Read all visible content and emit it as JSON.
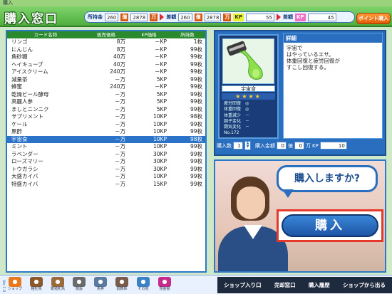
{
  "window": {
    "title": "購入"
  },
  "header": {
    "title": "購入窓口"
  },
  "money": {
    "funds_label": "所持金",
    "funds_oku": "260",
    "funds_man": "2878",
    "oku_unit": "億",
    "man_unit": "万",
    "diff_label": "差額",
    "diff_oku": "260",
    "diff_man": "2878",
    "kp_label": "KP",
    "kp_value": "55",
    "kp_diff_label": "差額",
    "kp_diff_value": "45",
    "point_button": "ポイント購入"
  },
  "table": {
    "headers": [
      "カード名称",
      "販売価格",
      "KP価格",
      "所持数"
    ],
    "rows": [
      [
        "リンゴ",
        "8万",
        "－KP",
        "1枚"
      ],
      [
        "にんじん",
        "8万",
        "－KP",
        "99枚"
      ],
      [
        "角砂糖",
        "40万",
        "－KP",
        "99枚"
      ],
      [
        "ヘイキューブ",
        "40万",
        "－KP",
        "99枚"
      ],
      [
        "アイスクリーム",
        "240万",
        "－KP",
        "99枚"
      ],
      [
        "減量茶",
        "－万",
        "5KP",
        "99枚"
      ],
      [
        "蜂蜜",
        "240万",
        "－KP",
        "99枚"
      ],
      [
        "乾燥ビール酵母",
        "－万",
        "5KP",
        "99枚"
      ],
      [
        "高麗人参",
        "－万",
        "5KP",
        "99枚"
      ],
      [
        "ましとニンニク",
        "－万",
        "5KP",
        "99枚"
      ],
      [
        "サプリメント",
        "－万",
        "10KP",
        "98枚"
      ],
      [
        "ケール",
        "－万",
        "10KP",
        "99枚"
      ],
      [
        "黒酢",
        "－万",
        "10KP",
        "99枚"
      ],
      [
        "宇宙食",
        "－万",
        "10KP",
        "98枚"
      ],
      [
        "ミント",
        "－万",
        "10KP",
        "99枚"
      ],
      [
        "ラベンダー",
        "－万",
        "30KP",
        "99枚"
      ],
      [
        "ローズマリー",
        "－万",
        "30KP",
        "99枚"
      ],
      [
        "トウガラシ",
        "－万",
        "30KP",
        "99枚"
      ],
      [
        "大盛カイバ",
        "－万",
        "10KP",
        "99枚"
      ],
      [
        "特盛カイバ",
        "－万",
        "15KP",
        "99枚"
      ]
    ],
    "selected_index": 13
  },
  "detail": {
    "card_name": "宇宙食",
    "stars": "★★★★",
    "stats": [
      {
        "label": "疲労回復",
        "value": "◎"
      },
      {
        "label": "体重回復",
        "value": "◎"
      },
      {
        "label": "体重減少",
        "value": "－"
      },
      {
        "label": "調子変化",
        "value": "－"
      },
      {
        "label": "闘気変化",
        "value": "－"
      }
    ],
    "card_no": "No.172",
    "desc_title": "詳細",
    "desc_text": "宇宙で\nはやっているエサ。\n体重回復と疲労回復が\nすこし回復する。"
  },
  "purchase": {
    "qty_label": "購入数",
    "qty_value": "1",
    "amount_label": "購入金額",
    "amount_oku": "0",
    "oku_unit": "億",
    "amount_man": "0",
    "man_unit": "万",
    "kp_label": "KP",
    "kp_value": "10"
  },
  "dialog": {
    "prompt": "購入しますか?",
    "buy_button": "購入"
  },
  "footer": {
    "version": "Ver.1.0",
    "icons": [
      {
        "label": "ショップ",
        "icon": "shop-icon",
        "color": "#e87a1e"
      },
      {
        "label": "種牡馬",
        "icon": "stallion-icon",
        "color": "#8a5a2b"
      },
      {
        "label": "繁殖牝馬",
        "icon": "mare-icon",
        "color": "#9b6a3a"
      },
      {
        "label": "施設",
        "icon": "facility-icon",
        "color": "#6a6a6a"
      },
      {
        "label": "馬券",
        "icon": "ticket-icon",
        "color": "#5a7aa0"
      },
      {
        "label": "調教師",
        "icon": "trainer-icon",
        "color": "#7a5b4b"
      },
      {
        "label": "その他",
        "icon": "other-icon",
        "color": "#3b82c4"
      },
      {
        "label": "預金額",
        "icon": "deposit-icon",
        "color": "#c42b8a"
      }
    ],
    "nav": [
      "ショップ入り口",
      "売却窓口",
      "購入履歴",
      "ショップから出る"
    ]
  }
}
